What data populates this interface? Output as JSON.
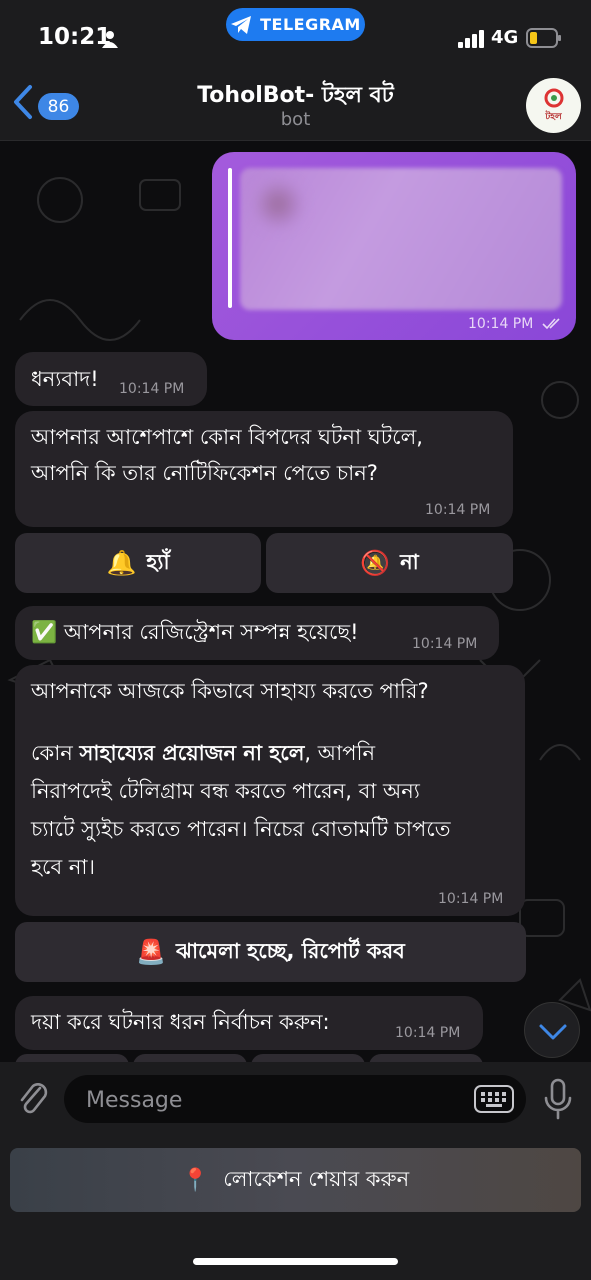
{
  "status_bar": {
    "time": "10:21",
    "pill_label": "TELEGRAM",
    "network": "4G"
  },
  "header": {
    "unread_count": "86",
    "title": "ToholBot- টহল বট",
    "subtitle": "bot",
    "avatar_text": "টহল"
  },
  "messages": [
    {
      "time": "10:14 PM",
      "outgoing": true
    },
    {
      "text": "ধন্যবাদ!",
      "time": "10:14 PM"
    },
    {
      "line1": "আপনার আশেপাশে কোন বিপদের ঘটনা ঘটলে,",
      "line2": "আপনি কি তার নোটিফিকেশন পেতে চান?",
      "time": "10:14 PM"
    },
    {
      "text": "✅ আপনার রেজিস্ট্রেশন সম্পন্ন হয়েছে!",
      "time": "10:14 PM"
    },
    {
      "line1": "আপনাকে আজকে কিভাবে সাহায্য করতে পারি?",
      "line2_pre": "কোন ",
      "line2_bold": "সাহায্যের প্রয়োজন না হলে",
      "line2_post": ", আপনি",
      "line3": "নিরাপদেই টেলিগ্রাম বন্ধ করতে পারেন, বা অন্য",
      "line4": "চ্যাটে স্যুইচ করতে পারেন। নিচের বোতামটি চাপতে",
      "line5": "হবে না।",
      "time": "10:14 PM"
    },
    {
      "text": "দয়া করে ঘটনার ধরন নির্বাচন করুন:",
      "time": "10:14 PM"
    }
  ],
  "buttons": {
    "yes": {
      "emoji": "🔔",
      "label": "হ্যাঁ"
    },
    "no": {
      "emoji": "🔕",
      "label": "না"
    },
    "report": {
      "emoji": "🚨",
      "label": "ঝামেলা হচ্ছে, রিপোর্ট করব"
    },
    "location": {
      "emoji": "📍",
      "label": "লোকেশন শেয়ার করুন"
    }
  },
  "input": {
    "placeholder": "Message"
  },
  "colors": {
    "accent": "#1e7bf0",
    "outgoing_bubble": "#9b55dc",
    "incoming_bubble": "#262328"
  }
}
